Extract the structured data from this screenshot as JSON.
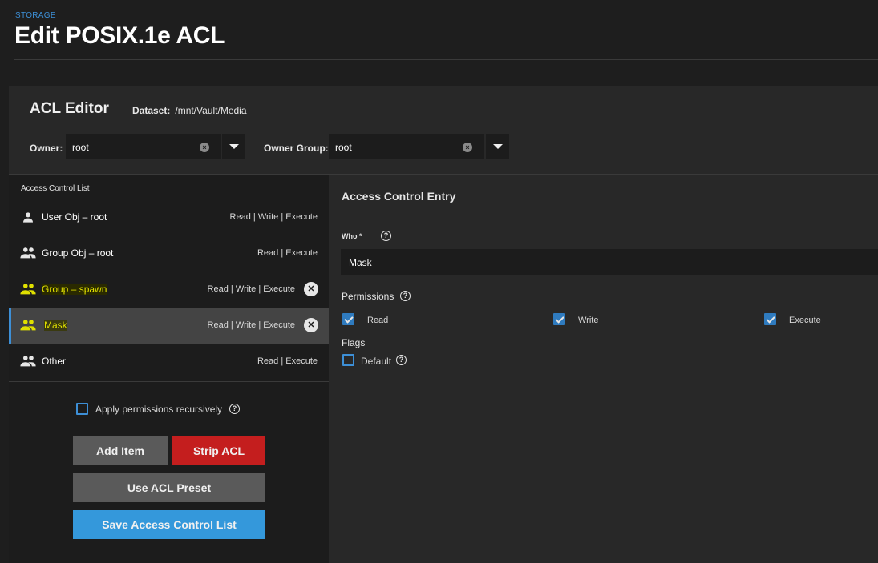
{
  "header": {
    "breadcrumb": "STORAGE",
    "title": "Edit POSIX.1e ACL"
  },
  "editor": {
    "title": "ACL Editor",
    "dataset_label": "Dataset:",
    "dataset_value": "/mnt/Vault/Media",
    "owner_label": "Owner:",
    "owner_value": "root",
    "owner_group_label": "Owner Group:",
    "owner_group_value": "root"
  },
  "acl_list": {
    "title": "Access Control List",
    "items": [
      {
        "name": "User Obj – root",
        "perms": "Read | Write | Execute",
        "icon": "person-icon",
        "removable": false
      },
      {
        "name": "Group Obj – root",
        "perms": "Read | Execute",
        "icon": "group-icon",
        "removable": false
      },
      {
        "name": "Group – spawn",
        "perms": "Read | Write | Execute",
        "icon": "group-icon",
        "removable": true
      },
      {
        "name": "Mask",
        "perms": "Read | Write | Execute",
        "icon": "group-icon",
        "removable": true,
        "selected": true
      },
      {
        "name": "Other",
        "perms": "Read | Execute",
        "icon": "group-icon",
        "removable": false
      }
    ],
    "recursive_label": "Apply permissions recursively",
    "recursive_checked": false
  },
  "buttons": {
    "add_item": "Add Item",
    "strip_acl": "Strip ACL",
    "use_preset": "Use ACL Preset",
    "save": "Save Access Control List"
  },
  "entry": {
    "title": "Access Control Entry",
    "who_label": "Who *",
    "who_value": "Mask",
    "permissions_label": "Permissions",
    "read_label": "Read",
    "write_label": "Write",
    "execute_label": "Execute",
    "read_checked": true,
    "write_checked": true,
    "execute_checked": true,
    "flags_label": "Flags",
    "default_label": "Default",
    "default_checked": false
  },
  "colors": {
    "accent": "#3d8fd6",
    "danger": "#c41e1e",
    "primary": "#3498db",
    "highlight": "#e0e000"
  }
}
